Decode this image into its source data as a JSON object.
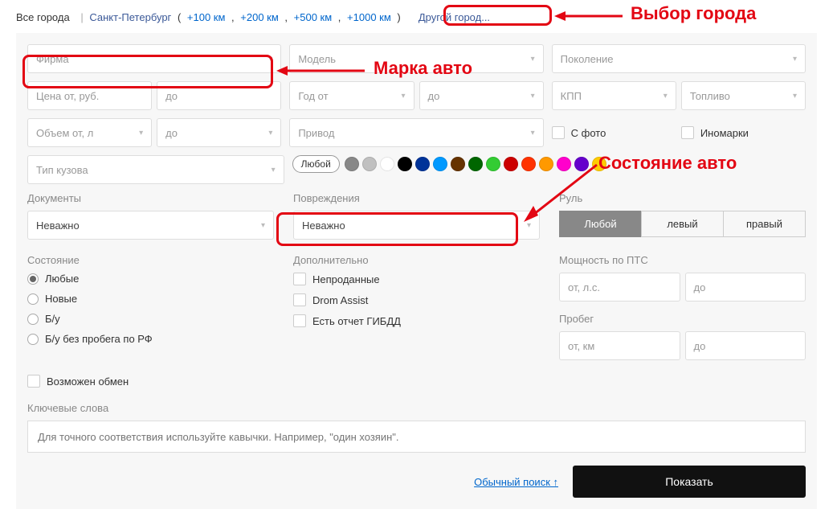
{
  "city_bar": {
    "all_cities": "Все города",
    "current_city": "Санкт-Петербург",
    "radii": [
      "+100 км",
      "+200 км",
      "+500 км",
      "+1000 км"
    ],
    "other_city": "Другой город..."
  },
  "filters": {
    "brand_placeholder": "Фирма",
    "model_placeholder": "Модель",
    "generation_placeholder": "Поколение",
    "price_from": "Цена от, руб.",
    "price_to": "до",
    "year_from": "Год от",
    "year_to": "до",
    "gearbox": "КПП",
    "fuel": "Топливо",
    "volume_from": "Объем от, л",
    "volume_to": "до",
    "drive": "Привод",
    "with_photo": "С фото",
    "foreign": "Иномарки",
    "body_type": "Тип кузова",
    "color_any": "Любой",
    "colors": [
      "#888888",
      "#c0c0c0",
      "#ffffff",
      "#000000",
      "#003399",
      "#0099ff",
      "#663300",
      "#006600",
      "#33cc33",
      "#cc0000",
      "#ff3300",
      "#ff9900",
      "#ff00cc",
      "#6600cc",
      "#ffcc00"
    ]
  },
  "documents": {
    "label": "Документы",
    "value": "Неважно"
  },
  "damage": {
    "label": "Повреждения",
    "value": "Неважно"
  },
  "wheel": {
    "label": "Руль",
    "any": "Любой",
    "left": "левый",
    "right": "правый"
  },
  "condition": {
    "label": "Состояние",
    "options": [
      "Любые",
      "Новые",
      "Б/у",
      "Б/у без пробега по РФ"
    ]
  },
  "extra": {
    "label": "Дополнительно",
    "unsold": "Непроданные",
    "assist": "Drom Assist",
    "gibdd": "Есть отчет ГИБДД"
  },
  "power": {
    "label": "Мощность по ПТС",
    "from": "от, л.с.",
    "to": "до"
  },
  "mileage": {
    "label": "Пробег",
    "from": "от, км",
    "to": "до"
  },
  "exchange": "Возможен обмен",
  "keywords": {
    "label": "Ключевые слова",
    "placeholder": "Для точного соответствия используйте кавычки. Например, \"один хозяин\"."
  },
  "footer": {
    "simple_search": "Обычный поиск ↑",
    "show": "Показать"
  },
  "annotations": {
    "city_label": "Выбор города",
    "brand_label": "Марка авто",
    "condition_label": "Состояние авто"
  }
}
